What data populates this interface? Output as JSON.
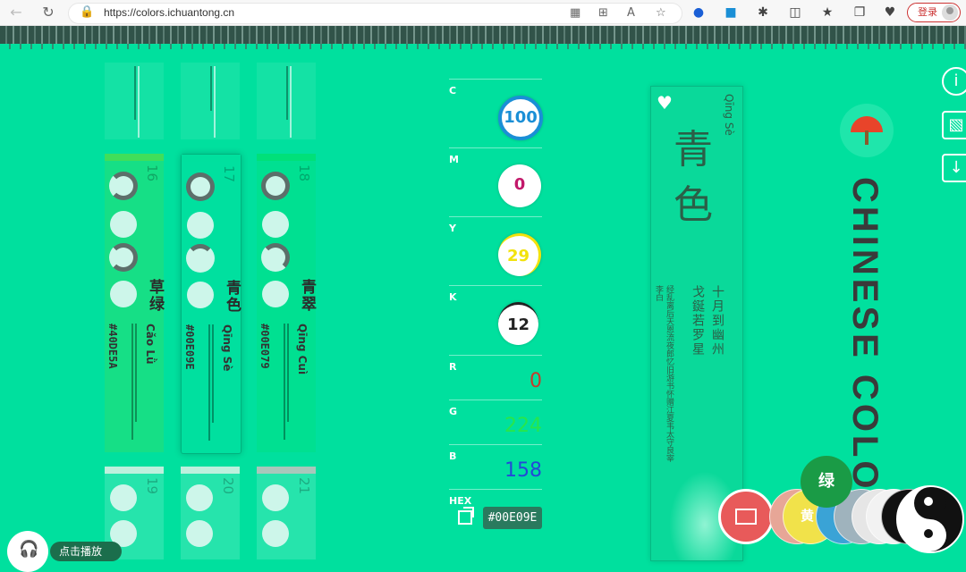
{
  "browser": {
    "url": "https://colors.ichuantong.cn",
    "login_label": "登录"
  },
  "cards_top": [
    {
      "bar": "#1fd99a"
    },
    {
      "bar": "#1fd99a"
    },
    {
      "bar": "#1fd99a"
    }
  ],
  "cards": [
    {
      "index": "16",
      "name": "草绿",
      "hex": "#40DE5A",
      "pinyin": "Cǎo Lǜ",
      "bar": "#40DE5A"
    },
    {
      "index": "17",
      "name": "青色",
      "hex": "#00E09E",
      "pinyin": "Qīng Sè",
      "bar": "#00E09E"
    },
    {
      "index": "18",
      "name": "青翠",
      "hex": "#00E079",
      "pinyin": "Qīng Cuì",
      "bar": "#00E079"
    }
  ],
  "cards_bottom": [
    {
      "index": "19"
    },
    {
      "index": "20"
    },
    {
      "index": "21"
    }
  ],
  "params": {
    "c_label": "C",
    "c": "100",
    "m_label": "M",
    "m": "0",
    "y_label": "Y",
    "y": "29",
    "k_label": "K",
    "k": "12",
    "r_label": "R",
    "r": "0",
    "g_label": "G",
    "g": "224",
    "b_label": "B",
    "b": "158",
    "hex_label": "HEX",
    "hex": "#00E09E"
  },
  "colors": {
    "cyan": "#1a8fd6",
    "magenta": "#c2186a",
    "yellow": "#f2e20c",
    "key": "#222222",
    "r_text": "#c83a2a",
    "g_text": "#27e64c",
    "b_text": "#2448d8"
  },
  "poem": {
    "name_line1": "青",
    "name_line2": "色",
    "pinyin": "Qīng Sè",
    "line1": "十月到幽州",
    "line2": "戈鋋若罗星",
    "author": "李白",
    "source": "经乱离后天恩流夜郎忆旧游书怀赠江夏韦太守良宰"
  },
  "brand": "CHINESE COLORS",
  "bubble_labels": {
    "green": "绿",
    "yellow": "黄"
  },
  "music": {
    "play_label": "点击播放"
  }
}
